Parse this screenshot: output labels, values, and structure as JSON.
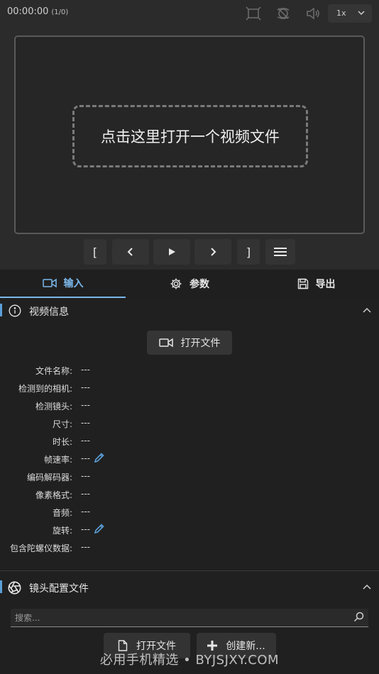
{
  "player": {
    "timecode": "00:00:00",
    "frame_counter": "(1/0)",
    "speed": "1x",
    "drop_zone_text": "点击这里打开一个视频文件"
  },
  "transport": {
    "mark_in": "[",
    "mark_out": "]"
  },
  "tabs": [
    {
      "label": "输入"
    },
    {
      "label": "参数"
    },
    {
      "label": "导出"
    }
  ],
  "video_info": {
    "title": "视频信息",
    "open_file_label": "打开文件",
    "rows": [
      {
        "label": "文件名称:",
        "value": "---"
      },
      {
        "label": "检测到的相机:",
        "value": "---"
      },
      {
        "label": "检测镜头:",
        "value": "---"
      },
      {
        "label": "尺寸:",
        "value": "---"
      },
      {
        "label": "时长:",
        "value": "---"
      },
      {
        "label": "帧速率:",
        "value": "---"
      },
      {
        "label": "编码解码器:",
        "value": "---"
      },
      {
        "label": "像素格式:",
        "value": "---"
      },
      {
        "label": "音频:",
        "value": "---"
      },
      {
        "label": "旋转:",
        "value": "---"
      },
      {
        "label": "包含陀螺仪数据:",
        "value": "---"
      }
    ]
  },
  "lens_profile": {
    "title": "镜头配置文件",
    "search_placeholder": "搜索...",
    "open_file_label": "打开文件",
    "create_new_label": "创建新..."
  },
  "watermark": "必用手机精选 • BYJSJXY.COM",
  "colors": {
    "accent": "#7cb8ea",
    "section_accent": "#5b9fd8",
    "background": "#2b2b2b",
    "panel": "#202020"
  }
}
